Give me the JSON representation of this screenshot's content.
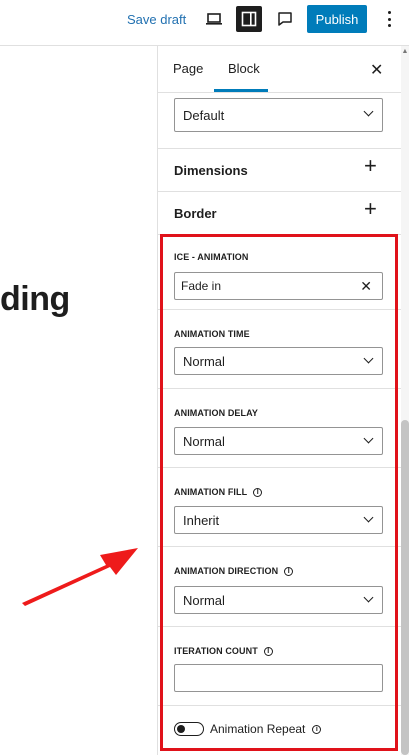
{
  "toolbar": {
    "save_draft": "Save draft",
    "publish": "Publish",
    "icons": [
      "desktop-preview-icon",
      "sidebar-toggle-icon",
      "comment-icon",
      "more-options-icon"
    ]
  },
  "canvas": {
    "heading_fragment": "ding"
  },
  "sidebar": {
    "tabs": [
      {
        "label": "Page"
      },
      {
        "label": "Block"
      }
    ],
    "active_tab": "Block",
    "top_select": {
      "value": "Default"
    },
    "panels": [
      {
        "title": "Dimensions"
      },
      {
        "title": "Border"
      }
    ]
  },
  "ice": {
    "animation": {
      "label": "ICE - ANIMATION",
      "value": "Fade in"
    },
    "time": {
      "label": "ANIMATION TIME",
      "value": "Normal"
    },
    "delay": {
      "label": "ANIMATION DELAY",
      "value": "Normal"
    },
    "fill": {
      "label": "ANIMATION FILL",
      "value": "Inherit"
    },
    "direction": {
      "label": "ANIMATION DIRECTION",
      "value": "Normal"
    },
    "iteration": {
      "label": "ITERATION COUNT",
      "value": ""
    },
    "repeat": {
      "label": "Animation Repeat",
      "enabled": false
    }
  },
  "colors": {
    "accent": "#007cba",
    "highlight": "#e0121a",
    "arrow": "#ee1b1b"
  }
}
